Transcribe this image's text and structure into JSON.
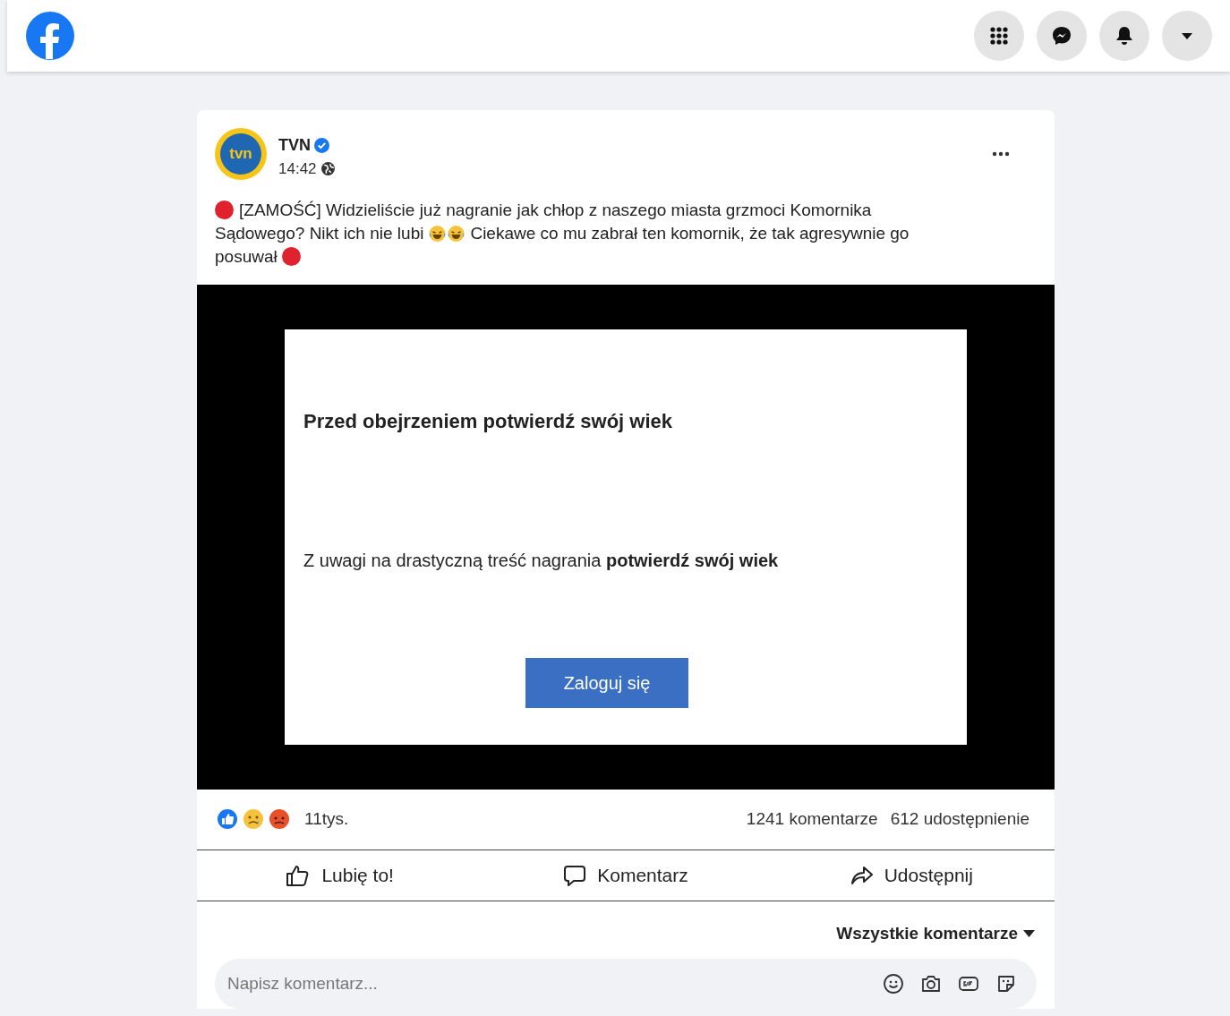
{
  "top_bar": {
    "buttons": [
      {
        "kind": "menu"
      },
      {
        "kind": "messenger"
      },
      {
        "kind": "notifications"
      },
      {
        "kind": "account"
      }
    ]
  },
  "post": {
    "author": "TVN",
    "verified": true,
    "time": "14:42",
    "avatar_text": "tvn",
    "text_lines": [
      "[ZAMOŚĆ] Widzieliście już nagranie jak chłop z naszego miasta grzmoci Komornika",
      "Sądowego? Nikt ich nie lubi",
      "Ciekawe co mu zabrał ten komornik, że tak agresywnie go",
      "posuwał"
    ],
    "dialog": {
      "title": "Przed obejrzeniem potwierdź swój wiek",
      "message": "Z uwagi na drastyczną treść nagrania **potwierdź swój wiek**",
      "button": "Zaloguj się"
    },
    "reactions_count": "11tys.",
    "comments_count": "1241 komentarze",
    "shares_count": "612 udostępnienie",
    "actions": [
      {
        "kind": "like",
        "label": "Lubię to!"
      },
      {
        "kind": "comment",
        "label": "Komentarz"
      },
      {
        "kind": "share",
        "label": "Udostępnij"
      }
    ],
    "comment_filter": "Wszystkie komentarze",
    "comment_field": {
      "placeholder": "Napisz komentarz..."
    }
  }
}
